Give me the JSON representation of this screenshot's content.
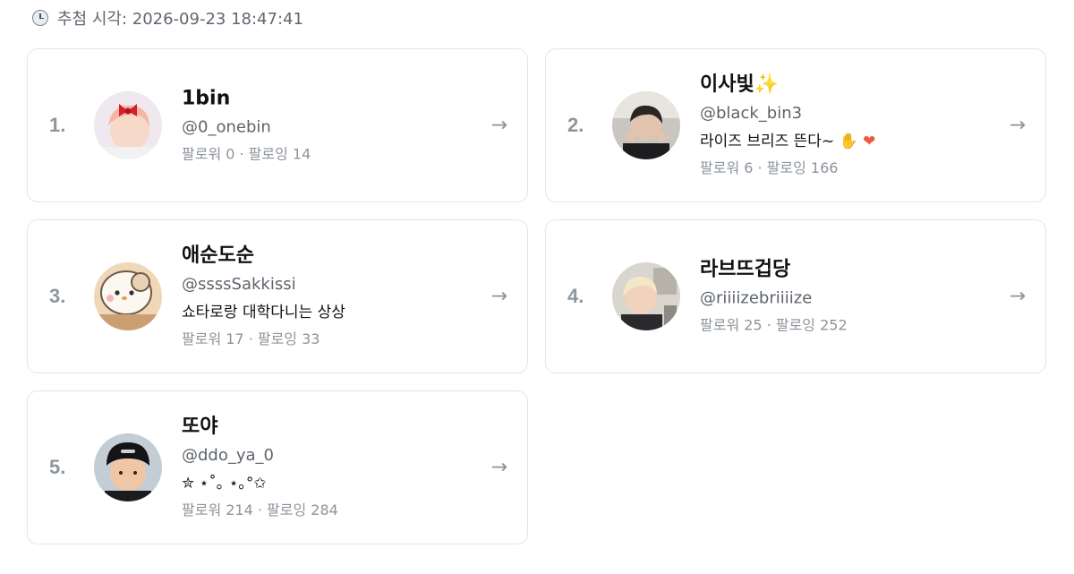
{
  "header": {
    "draw_label": "추첨 시각: 2026-09-23 18:47:41",
    "icon": "clock-icon"
  },
  "arrow_glyph": "→",
  "cards": [
    {
      "rank": "1.",
      "name": "1bin",
      "handle": "@0_onebin",
      "bio": "",
      "stats": "팔로워 0 · 팔로잉 14"
    },
    {
      "rank": "2.",
      "name": "이사빛",
      "name_emoji": "✨",
      "handle": "@black_bin3",
      "bio": "라이즈 브리즈 뜬다~",
      "bio_emoji_1": "✋",
      "bio_emoji_2": "❤",
      "stats": "팔로워 6 · 팔로잉 166"
    },
    {
      "rank": "3.",
      "name": "애순도순",
      "handle": "@ssssSakkissi",
      "bio": "쇼타로랑 대학다니는 상상",
      "stats": "팔로워 17 · 팔로잉 33"
    },
    {
      "rank": "4.",
      "name": "라브뜨겁당",
      "handle": "@riiiizebriiiize",
      "bio": "",
      "stats": "팔로워 25 · 팔로잉 252"
    },
    {
      "rank": "5.",
      "name": "또야",
      "handle": "@ddo_ya_0",
      "bio": "✮ ⋆˚｡ ⋆｡°✩",
      "stats": "팔로워 214 · 팔로잉 284"
    }
  ]
}
